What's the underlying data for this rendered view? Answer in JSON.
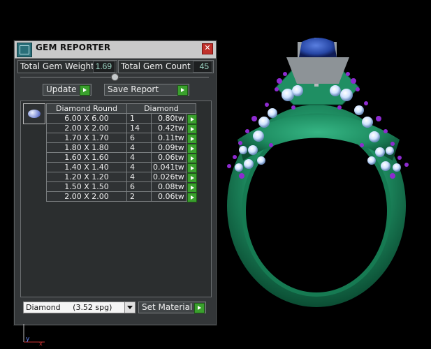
{
  "window": {
    "title": "GEM REPORTER",
    "close_icon": "close-icon"
  },
  "totals": {
    "weight_label": "Total Gem Weight",
    "weight_value": "1.69",
    "count_label": "Total Gem Count",
    "count_value": "45"
  },
  "actions": {
    "update_label": "Update",
    "save_report_label": "Save Report",
    "set_material_label": "Set Material"
  },
  "table": {
    "headers": [
      "Diamond Round",
      "Diamond"
    ],
    "rows": [
      {
        "size": "6.00 X 6.00",
        "qty": "1",
        "weight": "0.80tw"
      },
      {
        "size": "2.00 X 2.00",
        "qty": "14",
        "weight": "0.42tw"
      },
      {
        "size": "1.70 X 1.70",
        "qty": "6",
        "weight": "0.11tw"
      },
      {
        "size": "1.80 X 1.80",
        "qty": "4",
        "weight": "0.09tw"
      },
      {
        "size": "1.60 X 1.60",
        "qty": "4",
        "weight": "0.06tw"
      },
      {
        "size": "1.40 X 1.40",
        "qty": "4",
        "weight": "0.041tw"
      },
      {
        "size": "1.20 X 1.20",
        "qty": "4",
        "weight": "0.026tw"
      },
      {
        "size": "1.50 X 1.50",
        "qty": "6",
        "weight": "0.08tw"
      },
      {
        "size": "2.00 X 2.00",
        "qty": "2",
        "weight": "0.06tw"
      }
    ]
  },
  "material": {
    "selected": "Diamond     (3.52 spg)"
  },
  "axis": {
    "y_label": "y",
    "x_label": "x"
  },
  "colors": {
    "ring_metal": "#1f8f63",
    "center_stone": "#2747a6",
    "accent_stones": "#8e2bd0",
    "diamonds": "#cfe3ff",
    "prongs": "#9aa0a4"
  }
}
